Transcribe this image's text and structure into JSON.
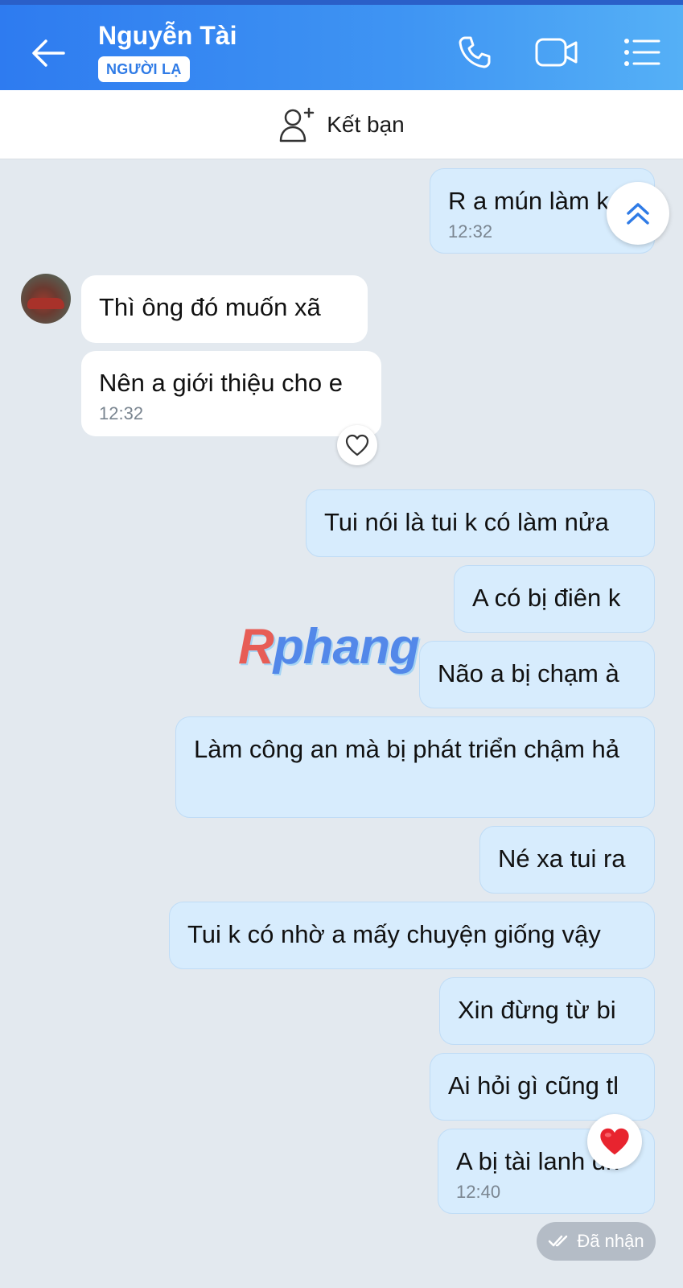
{
  "header": {
    "contact_name": "Nguyễn Tài",
    "badge": "NGƯỜI LẠ"
  },
  "friend_bar": {
    "label": "Kết bạn"
  },
  "messages": [
    {
      "dir": "out",
      "text": "R a mún làm k",
      "time": "12:32"
    },
    {
      "dir": "in",
      "text": "Thì ông đó muốn xã"
    },
    {
      "dir": "in",
      "text": "Nên a giới thiệu cho e",
      "time": "12:32"
    },
    {
      "dir": "out",
      "text": "Tui nói là tui k có làm nửa"
    },
    {
      "dir": "out",
      "text": "A có bị điên k"
    },
    {
      "dir": "out",
      "text": "Não a bị chạm à"
    },
    {
      "dir": "out",
      "text": "Làm công an mà bị phát triển chậm hả"
    },
    {
      "dir": "out",
      "text": "Né xa tui ra"
    },
    {
      "dir": "out",
      "text": "Tui k có nhờ a mấy chuyện giống vậy"
    },
    {
      "dir": "out",
      "text": "Xin đừng từ bi"
    },
    {
      "dir": "out",
      "text": "Ai hỏi gì cũng tl"
    },
    {
      "dir": "out",
      "text": "A bị tài lanh dk",
      "time": "12:40"
    }
  ],
  "watermark": {
    "first": "R",
    "rest": "phang"
  },
  "status": {
    "label": "Đã nhận"
  },
  "icons": [
    "back-arrow-icon",
    "phone-icon",
    "video-icon",
    "menu-icon",
    "add-friend-icon",
    "heart-outline-icon",
    "scroll-up-icon",
    "heart-icon",
    "double-check-icon"
  ],
  "colors": {
    "header": "#3f8ff2",
    "outgoing_bubble": "#d7ecfd",
    "incoming_bubble": "#ffffff",
    "background": "#e3e9ef"
  }
}
